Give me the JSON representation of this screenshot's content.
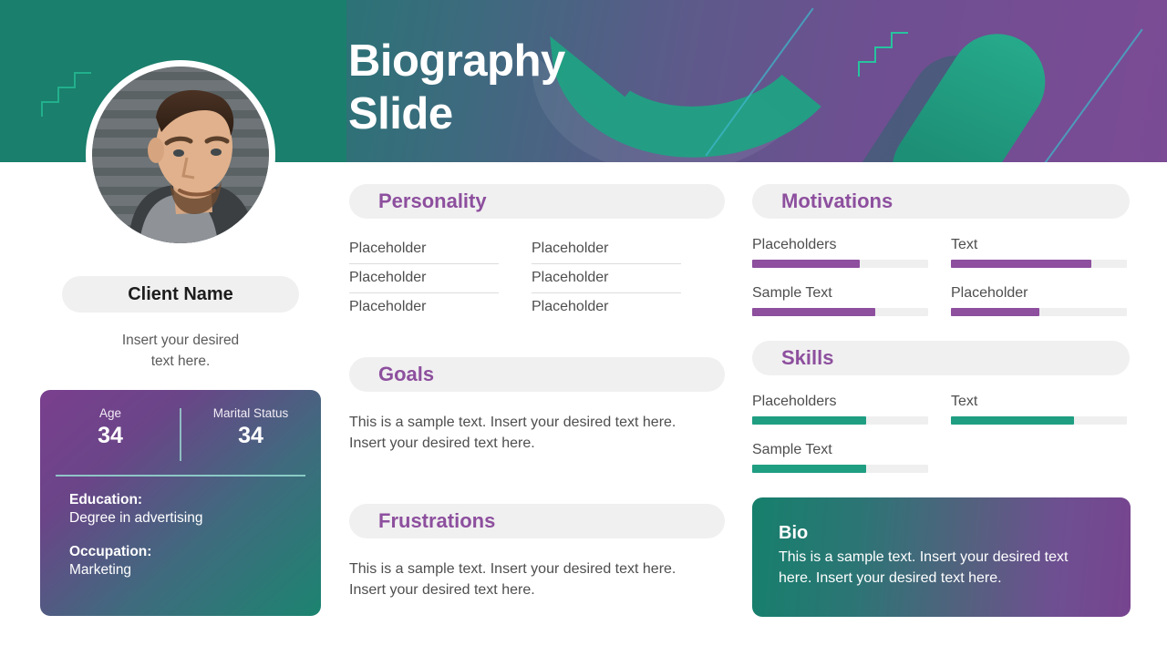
{
  "header": {
    "title": "Biography\nSlide"
  },
  "profile": {
    "avatar_alt": "client-portrait",
    "name": "Client Name",
    "subtitle": "Insert your desired\ntext here.",
    "stats": [
      {
        "label": "Age",
        "value": "34"
      },
      {
        "label": "Marital Status",
        "value": "34"
      }
    ],
    "details": [
      {
        "key": "Education:",
        "value": "Degree in advertising"
      },
      {
        "key": "Occupation:",
        "value": "Marketing"
      }
    ]
  },
  "sections": {
    "personality": {
      "title": "Personality",
      "items_left": [
        "Placeholder",
        "Placeholder",
        "Placeholder"
      ],
      "items_right": [
        "Placeholder",
        "Placeholder",
        "Placeholder"
      ]
    },
    "goals": {
      "title": "Goals",
      "body": "This is a sample text. Insert your desired text here. Insert your desired text here."
    },
    "frustrations": {
      "title": "Frustrations",
      "body": "This is a sample text. Insert your desired text here. Insert your desired text here."
    },
    "motivations": {
      "title": "Motivations",
      "bars": [
        {
          "label": "Placeholders",
          "percent": 61
        },
        {
          "label": "Text",
          "percent": 80
        },
        {
          "label": "Sample Text",
          "percent": 70
        },
        {
          "label": "Placeholder",
          "percent": 50
        }
      ]
    },
    "skills": {
      "title": "Skills",
      "bars": [
        {
          "label": "Placeholders",
          "percent": 65
        },
        {
          "label": "Text",
          "percent": 70
        },
        {
          "label": "Sample Text",
          "percent": 65
        }
      ]
    },
    "bio": {
      "title": "Bio",
      "body": "This is a sample text. Insert your desired text here. Insert your desired text here."
    }
  },
  "colors": {
    "teal": "#1f9e82",
    "purple": "#8d4f9e",
    "pill_bg": "#f0f0f0",
    "text": "#4e4e4e",
    "header_teal": "#1a7f6c",
    "header_purple": "#7b4b95"
  }
}
